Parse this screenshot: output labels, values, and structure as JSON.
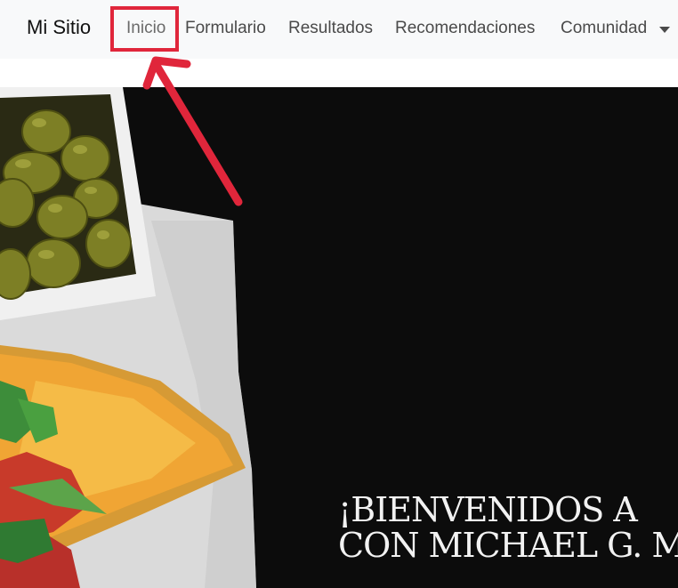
{
  "navbar": {
    "brand": "Mi Sitio",
    "items": [
      {
        "label": "Inicio"
      },
      {
        "label": "Formulario"
      },
      {
        "label": "Resultados"
      },
      {
        "label": "Recomendaciones"
      },
      {
        "label": "Comunidad"
      }
    ]
  },
  "hero": {
    "line1": "¡BIENVENIDOS A",
    "line2": "CON MICHAEL G. M"
  },
  "annotation": {
    "color": "#e0263b"
  },
  "colors": {
    "navbar_bg": "#f8f9fa",
    "hero_bg": "#0c0c0c"
  }
}
